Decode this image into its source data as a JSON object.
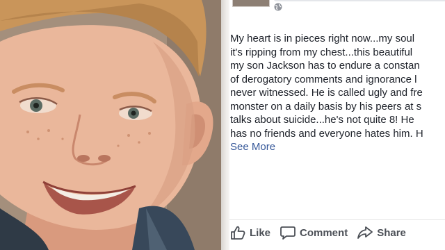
{
  "post": {
    "text_lines": [
      "My heart is in pieces right now...my soul",
      "it's ripping from my chest...this beautiful",
      "my son Jackson has to endure a constan",
      "of derogatory comments and ignorance l",
      "never witnessed. He is called ugly and fre",
      "monster on a daily basis by his peers at s",
      "talks about suicide...he's not quite 8! He",
      "has no friends and everyone hates him. H"
    ],
    "see_more": "See More",
    "privacy_icon": "globe-icon"
  },
  "actions": {
    "like": {
      "label": "Like",
      "icon": "thumbs-up-icon"
    },
    "comment": {
      "label": "Comment",
      "icon": "speech-bubble-icon"
    },
    "share": {
      "label": "Share",
      "icon": "share-arrow-icon"
    }
  },
  "colors": {
    "link": "#365899",
    "text": "#1d2129",
    "action": "#4b4f56"
  }
}
